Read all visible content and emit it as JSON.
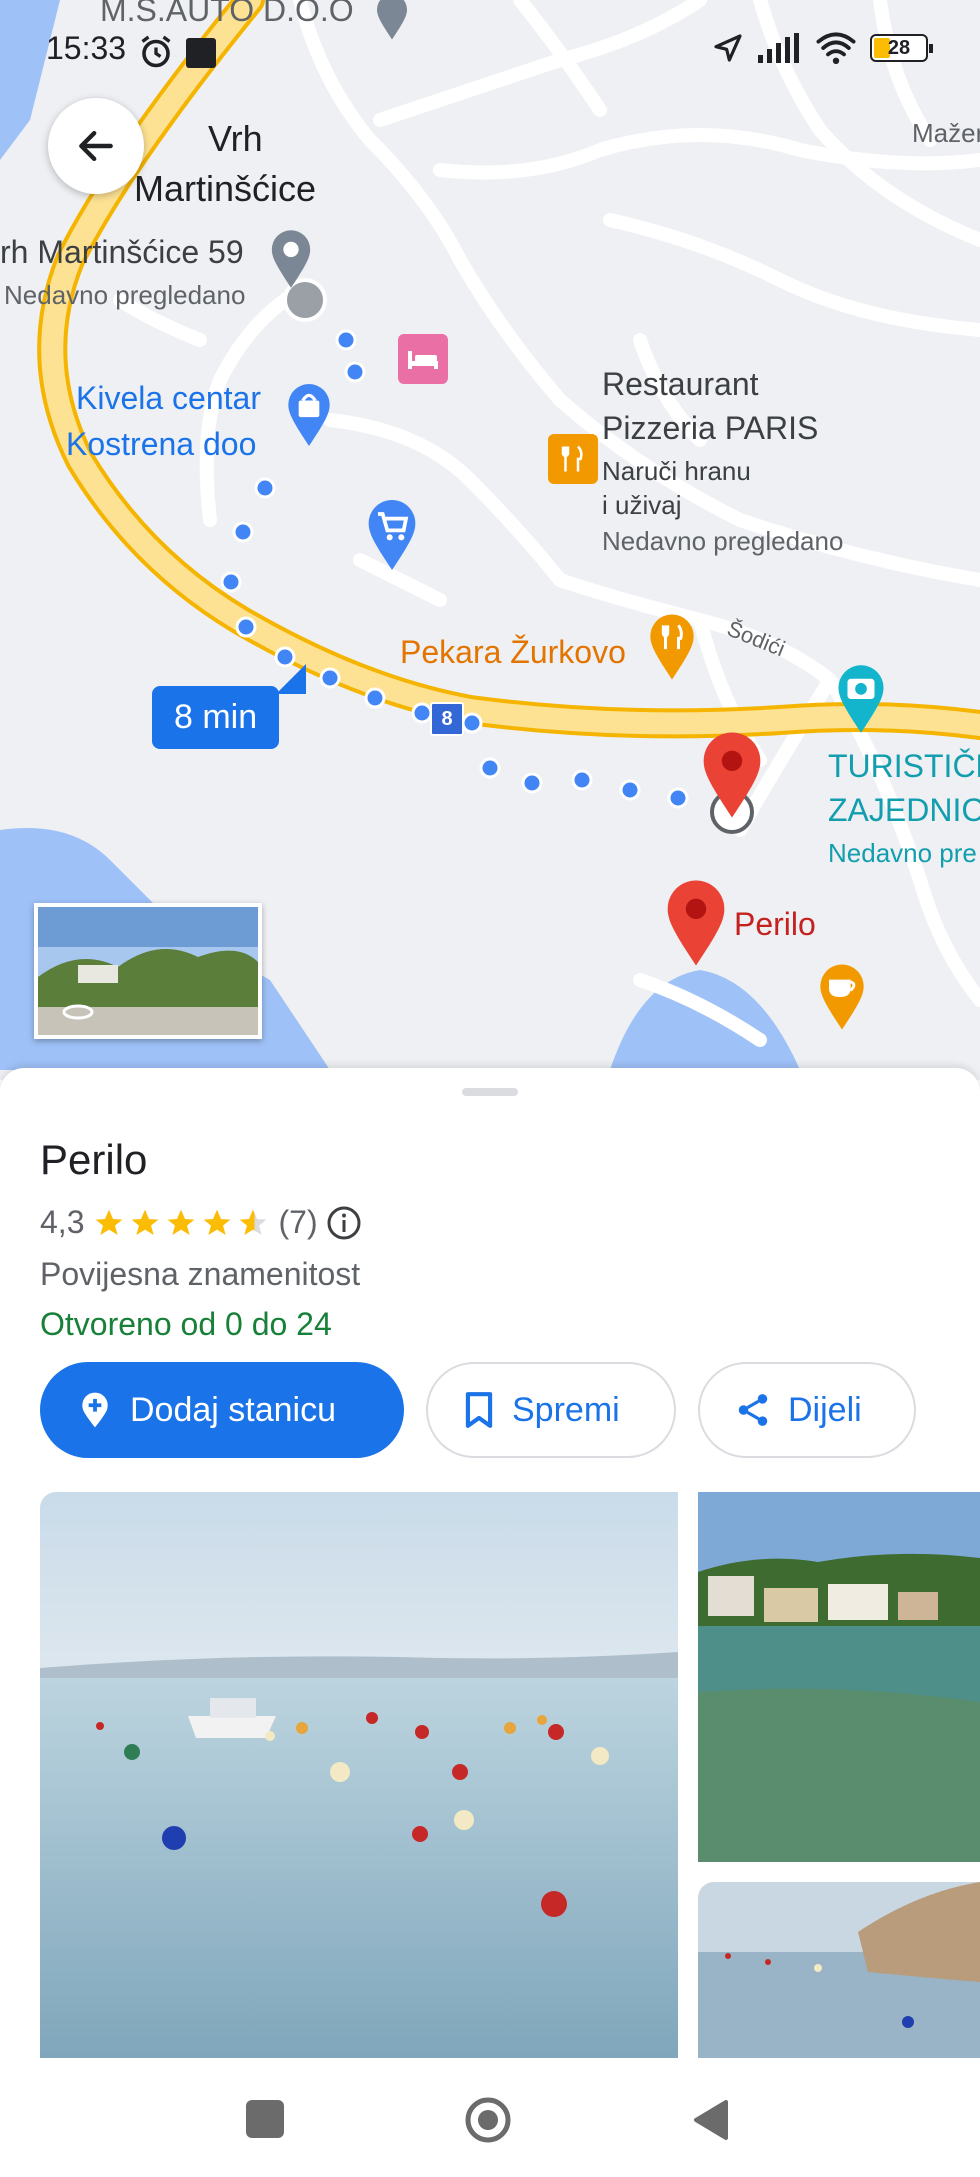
{
  "status_bar": {
    "time": "15:33",
    "battery": "28"
  },
  "map": {
    "labels": {
      "ms_auto": "M.S.AUTO D.O.O",
      "vrh_line1": "Vrh",
      "vrh_line2": "Martinšćice",
      "mazer": "Mažer",
      "address": "rh Martinšćice 59",
      "address_sub": "Nedavno pregledano",
      "kivela_line1": "Kivela centar",
      "kivela_line2": "Kostrena doo",
      "restaurant_line1": "Restaurant",
      "restaurant_line2": "Pizzeria PARIS",
      "restaurant_sub1": "Naruči hranu",
      "restaurant_sub2": "i uživaj",
      "restaurant_sub3": "Nedavno pregledano",
      "pekara": "Pekara Žurkovo",
      "sodici": "Šodići",
      "turist_line1": "TURISTIČK",
      "turist_line2": "ZAJEDNIC",
      "turist_sub": "Nedavno pre",
      "road_number": "8",
      "perilo": "Perilo"
    },
    "eta": "8 min"
  },
  "place": {
    "title": "Perilo",
    "rating": "4,3",
    "rating_value": 4.3,
    "review_count": "(7)",
    "category": "Povijesna znamenitost",
    "hours": "Otvoreno od 0 do 24"
  },
  "actions": {
    "add_stop": "Dodaj stanicu",
    "save": "Spremi",
    "share": "Dijeli"
  },
  "colors": {
    "accent": "#1a73e8",
    "open_green": "#188038",
    "star": "#fbbc04",
    "road_yellow": "#fdd663",
    "pin_red": "#ea4335"
  }
}
